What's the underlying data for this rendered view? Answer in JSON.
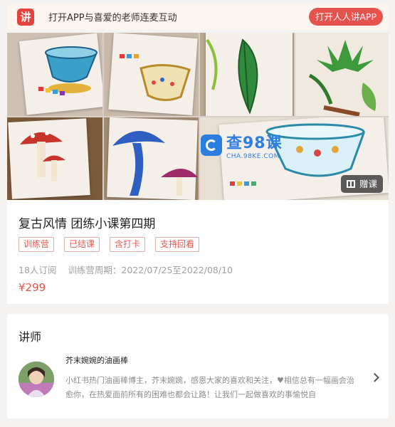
{
  "banner": {
    "logo_char": "讲",
    "text": "打开APP与喜爱的老师连麦互动",
    "open_button": "打开人人讲APP"
  },
  "cover": {
    "image": "watercolor painting collage: teacups, mushrooms, leaves",
    "watermark_main": "查98课",
    "watermark_sub": "CHA.98KE.COM",
    "gift_button": "赠课"
  },
  "course": {
    "title": "复古风情 团练小课第四期",
    "tags": [
      "训练营",
      "已结课",
      "含打卡",
      "支持回看"
    ],
    "subscribers": "18人订阅",
    "period": "训练营周期：2022/07/25至2022/08/10",
    "price": "¥299"
  },
  "teacher": {
    "section_title": "讲师",
    "name": "芥末婉婉的油画棒",
    "description": "小红书热门油画棒博主，芥末婉婉，感恩大家的喜欢和关注，♥相信总有一幅画会治愈你，在热爱面前所有的困难也都会让路！让我们一起做喜欢的事愉悦自"
  },
  "colors": {
    "accent": "#e6534c",
    "tag_border": "#e8a9a4",
    "page_bg": "#f5f3f1"
  },
  "icons": {
    "app_logo": "renren-jiang-logo",
    "gift": "gift-icon",
    "chevron": "chevron-right-icon"
  }
}
